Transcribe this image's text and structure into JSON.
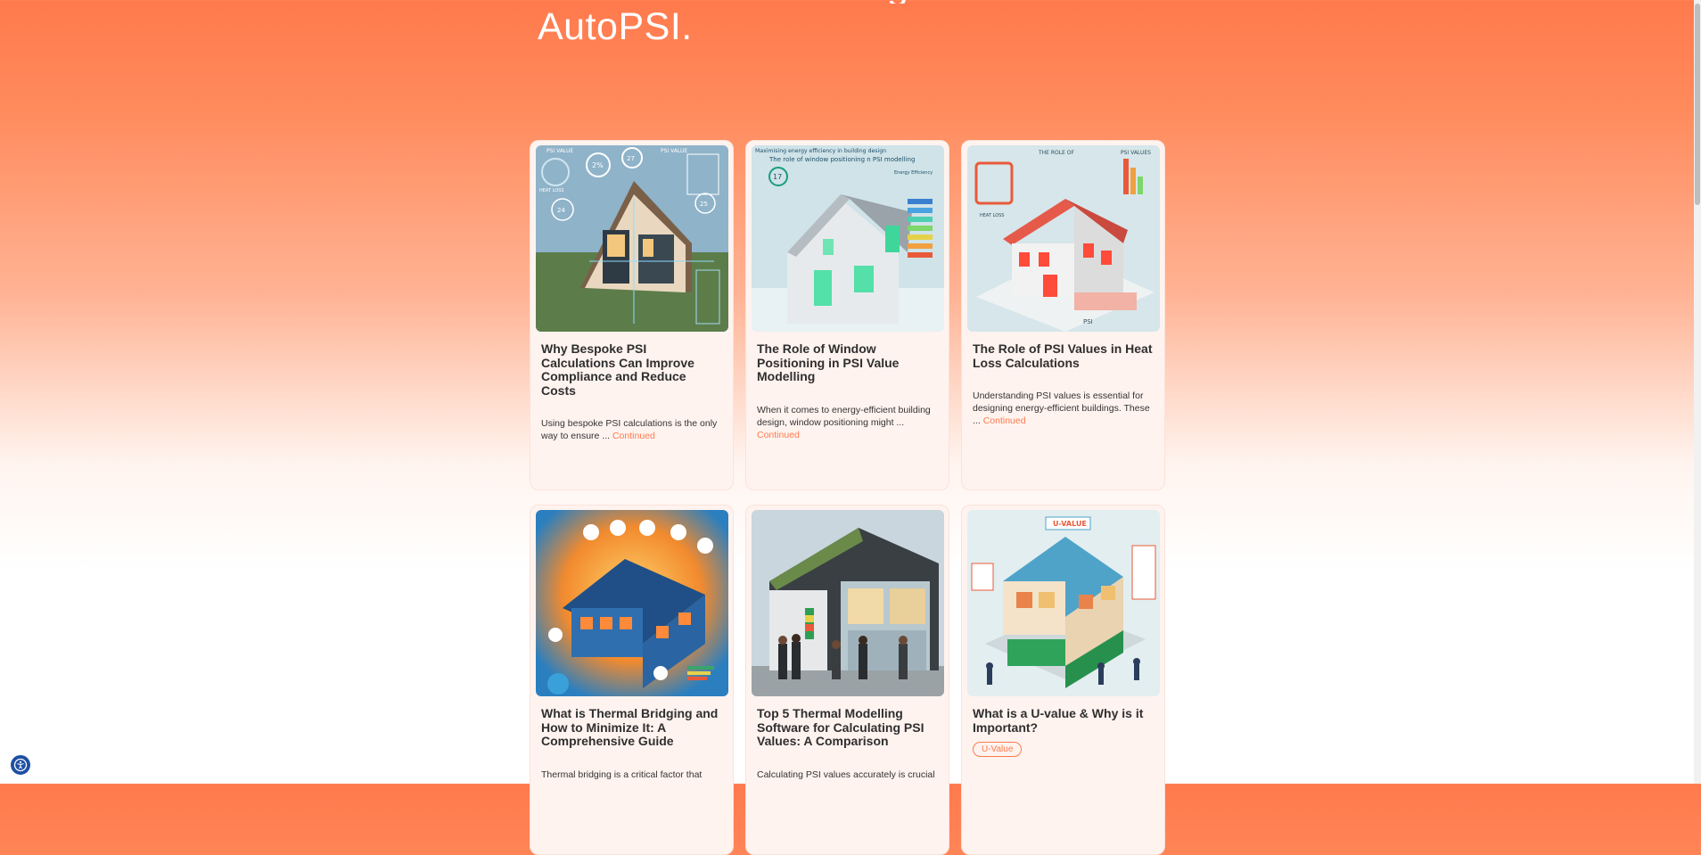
{
  "hero": {
    "title": "AutoPSI."
  },
  "posts": [
    {
      "title": "Why Bespoke PSI Calculations Can Improve Compliance and Reduce Costs",
      "excerpt": "Using bespoke PSI calculations is the only way to ensure ...",
      "link": "Continued",
      "image": "house-psi-values-illustration",
      "image_texts": [
        "PSI VALUE",
        "PSI VALUE",
        "2%",
        "27",
        "HEAT LOSS",
        "24",
        "25"
      ]
    },
    {
      "title": "The Role of Window Positioning in PSI Value Modelling",
      "excerpt": "When it comes to energy-efficient building design, window positioning might ...",
      "link": "Continued",
      "image": "window-positioning-house-illustration",
      "image_texts": [
        "Maximising energy efficiency in building design",
        "The role of window positioning n PSI modelling",
        "17",
        "Energy Efficiency"
      ]
    },
    {
      "title": "The Role of PSI Values in Heat Loss Calculations",
      "excerpt": "Understanding PSI values is essential for designing energy-efficient buildings. These ...",
      "link": "Continued",
      "image": "heat-loss-house-illustration",
      "image_texts": [
        "THE ROLE OF",
        "PSI VALUES",
        "HEAT LOSS",
        "PSI"
      ]
    },
    {
      "title": "What is Thermal Bridging and How to Minimize It: A Comprehensive Guide",
      "excerpt": "Thermal bridging is a critical factor that",
      "link": "",
      "image": "thermal-bridging-house-illustration",
      "image_texts": []
    },
    {
      "title": "Top 5 Thermal Modelling Software for Calculating PSI Values: A Comparison",
      "excerpt": "Calculating PSI values accurately is crucial",
      "link": "",
      "image": "thermal-modelling-building-photo",
      "image_texts": []
    },
    {
      "title": "What is a U-value & Why is it Important?",
      "excerpt": "",
      "link": "",
      "tag": "U-Value",
      "image": "u-value-house-cutaway-illustration",
      "image_texts": [
        "U-VALUE"
      ]
    }
  ],
  "colors": {
    "accent": "#ff7a4d",
    "card_bg": "#fff3ef",
    "title": "#2f2f2f"
  },
  "accessibility": {
    "icon": "accessibility-icon"
  }
}
